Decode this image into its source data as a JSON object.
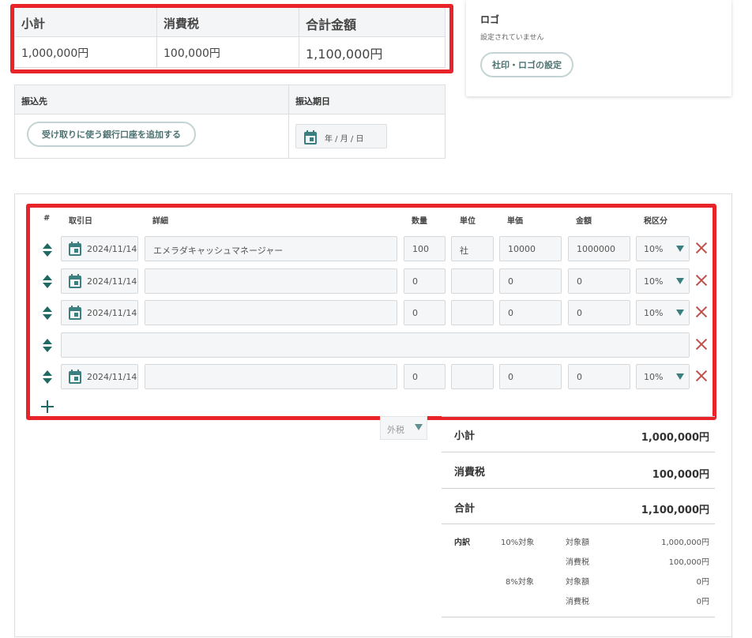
{
  "summary": {
    "subtotal_label": "小計",
    "tax_label": "消費税",
    "total_label": "合計金額",
    "subtotal_value": "1,000,000円",
    "tax_value": "100,000円",
    "total_value": "1,100,000円"
  },
  "logo": {
    "title": "ロゴ",
    "status": "設定されていません",
    "button": "社印・ロゴの設定"
  },
  "bank": {
    "account_header": "振込先",
    "due_header": "振込期日",
    "add_button": "受け取りに使う銀行口座を追加する",
    "date_placeholder": "年 / 月 / 日"
  },
  "items": {
    "headers": {
      "no": "#",
      "date": "取引日",
      "detail": "詳細",
      "qty": "数量",
      "unit": "単位",
      "price": "単価",
      "amount": "金額",
      "tax": "税区分"
    },
    "rows": [
      {
        "date": "2024/11/14",
        "detail": "エメラダキャッシュマネージャー",
        "qty": "100",
        "unit": "社",
        "price": "10000",
        "amount": "1000000",
        "tax": "10%"
      },
      {
        "date": "2024/11/14",
        "detail": "",
        "qty": "0",
        "unit": "",
        "price": "0",
        "amount": "0",
        "tax": "10%"
      },
      {
        "date": "2024/11/14",
        "detail": "",
        "qty": "0",
        "unit": "",
        "price": "0",
        "amount": "0",
        "tax": "10%"
      },
      {
        "text": ""
      },
      {
        "date": "2024/11/14",
        "detail": "",
        "qty": "0",
        "unit": "",
        "price": "0",
        "amount": "0",
        "tax": "10%"
      }
    ]
  },
  "totals": {
    "tax_mode": "外税",
    "subtotal_label": "小計",
    "subtotal_value": "1,000,000円",
    "tax_label": "消費税",
    "tax_value": "100,000円",
    "total_label": "合計",
    "total_value": "1,100,000円",
    "breakdown": {
      "label": "内訳",
      "rate10": "10%対象",
      "rate10_base_label": "対象額",
      "rate10_base": "1,000,000円",
      "rate10_tax_label": "消費税",
      "rate10_tax": "100,000円",
      "rate8": "8%対象",
      "rate8_base_label": "対象額",
      "rate8_base": "0円",
      "rate8_tax_label": "消費税",
      "rate8_tax": "0円"
    }
  },
  "colors": {
    "accent": "#3b7f80",
    "highlight": "#e8242a",
    "delete": "#c0504d"
  }
}
